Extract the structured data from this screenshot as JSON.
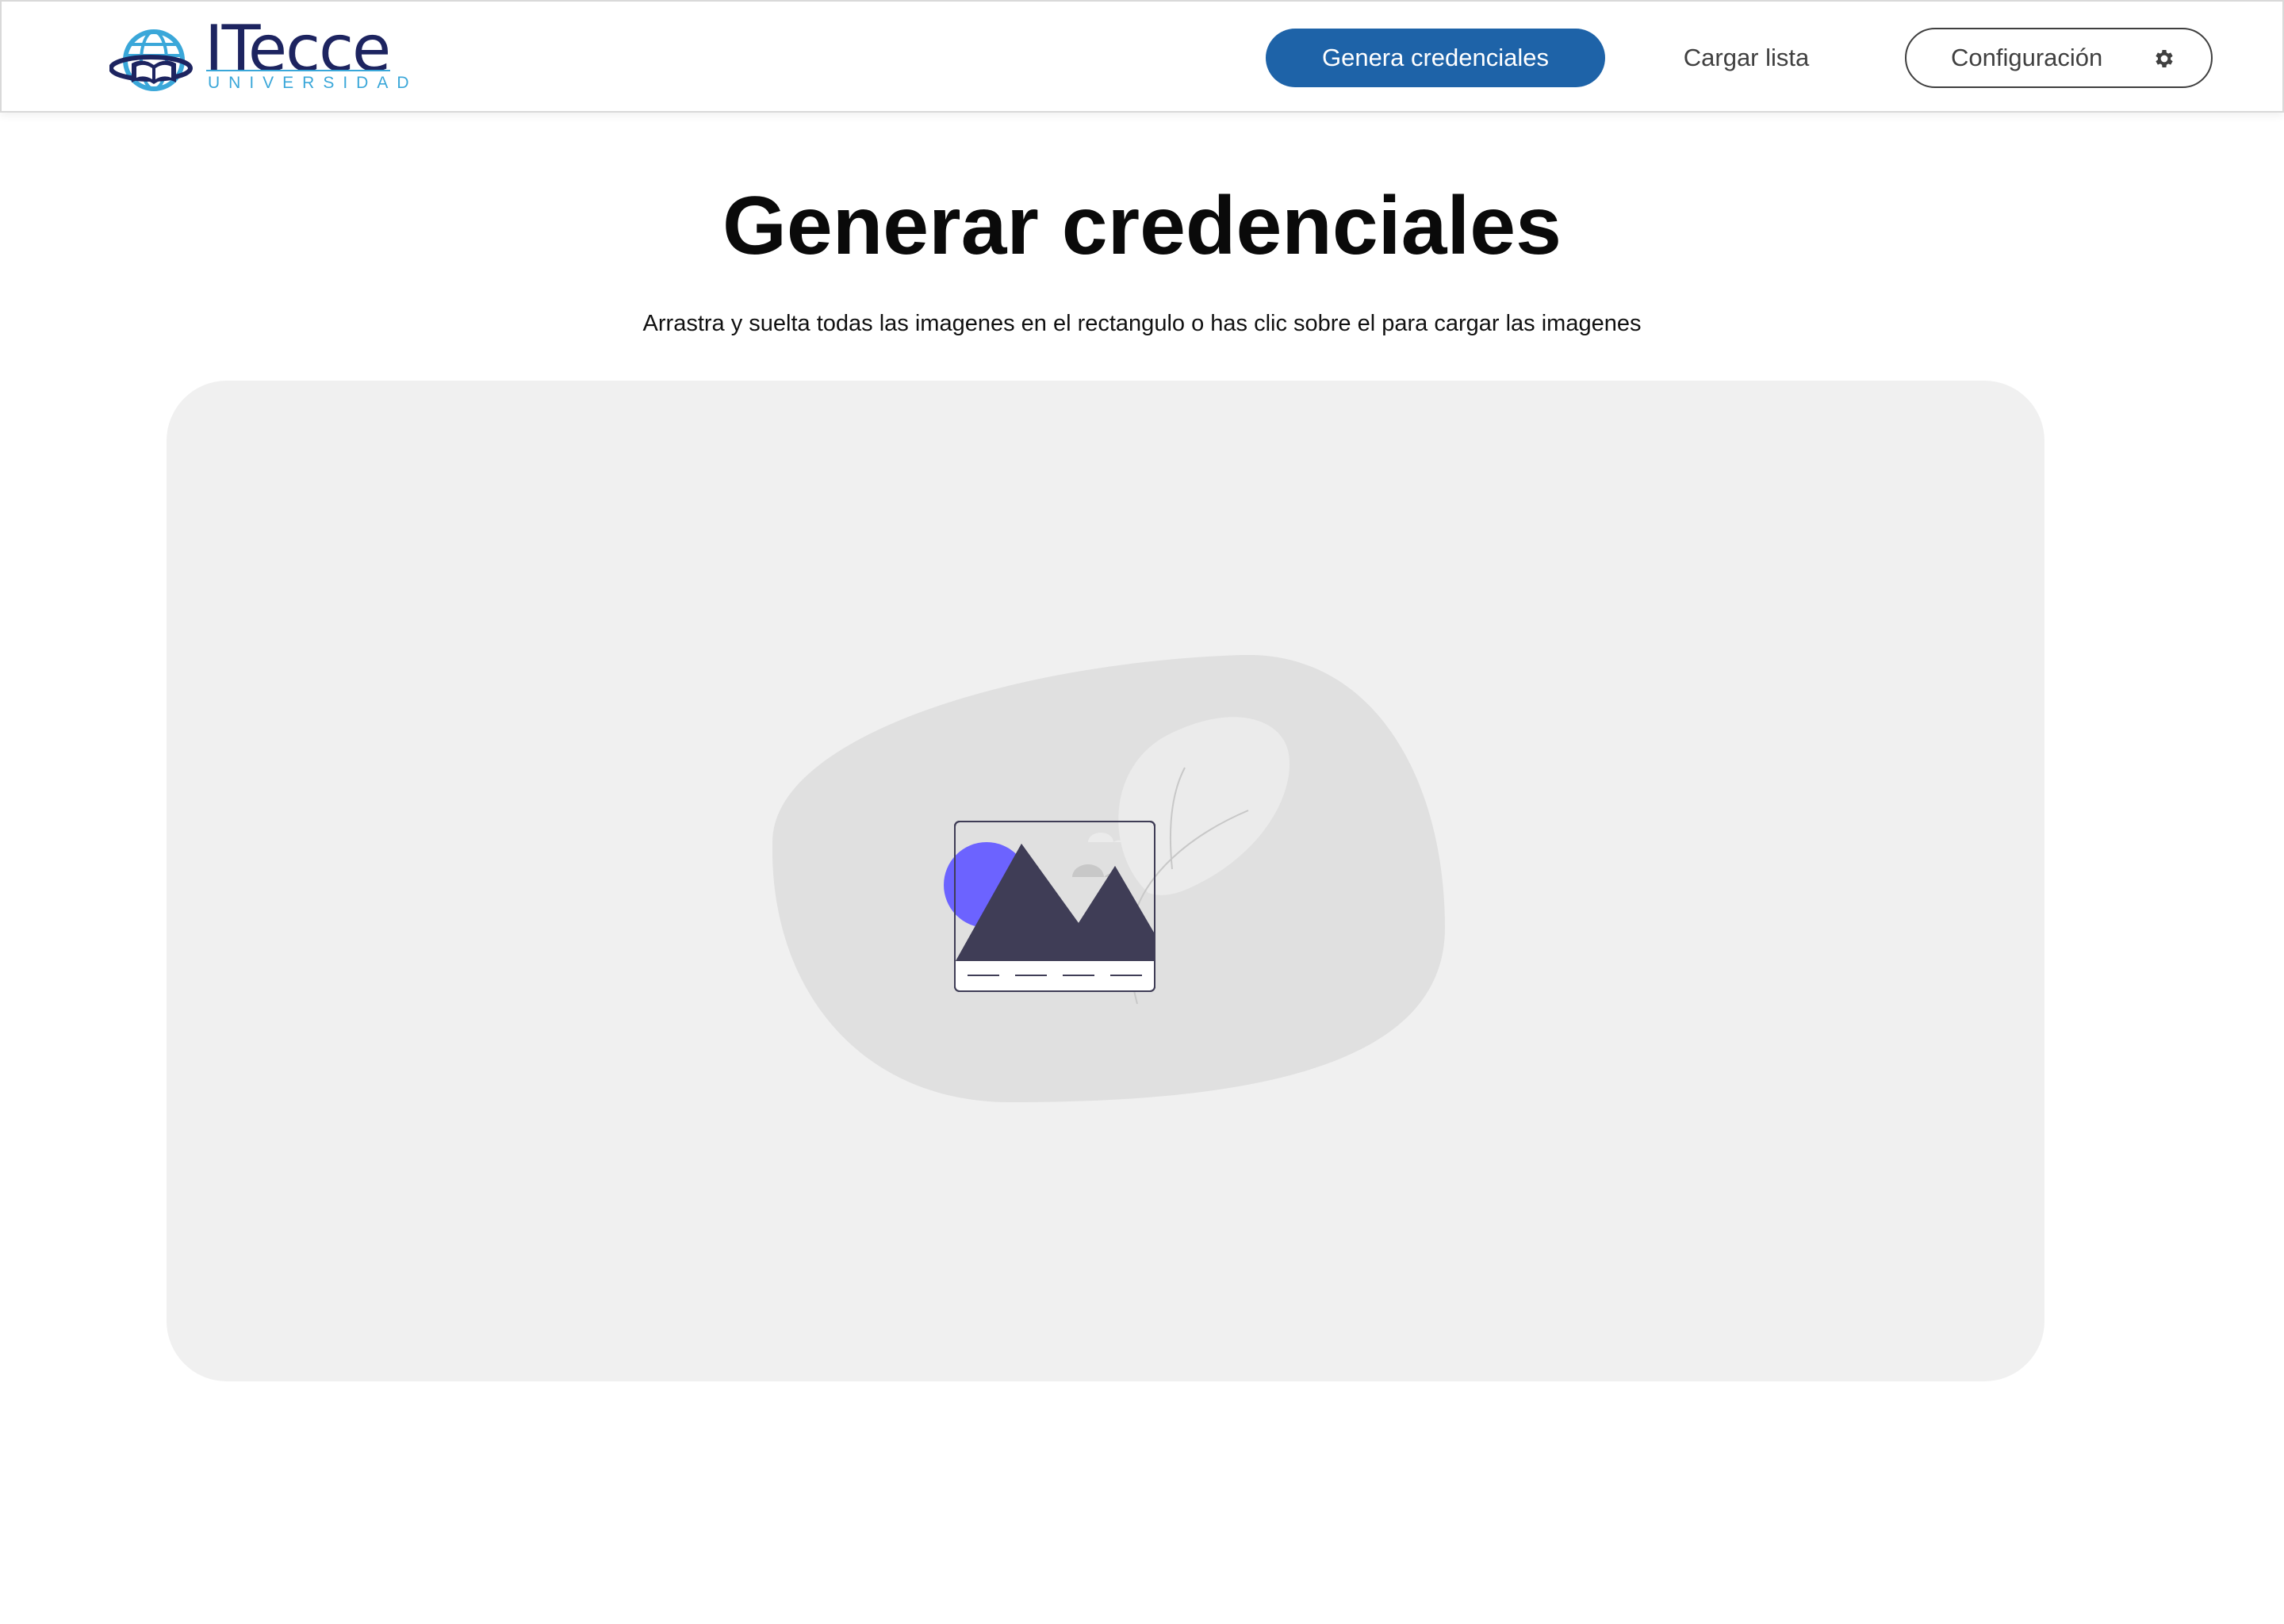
{
  "brand": {
    "name": "ITecce",
    "subtitle": "UNIVERSIDAD",
    "colors": {
      "dark": "#1d2460",
      "light": "#3aa7d9"
    }
  },
  "nav": {
    "primary_label": "Genera credenciales",
    "upload_list_label": "Cargar lista",
    "settings_label": "Configuración",
    "settings_icon": "gear-icon",
    "primary_color": "#1e63a8"
  },
  "main": {
    "title": "Generar credenciales",
    "instructions": "Arrastra y suelta todas las imagenes en el rectangulo o has clic sobre el para cargar las imagenes"
  },
  "dropzone": {
    "illustration": "image-upload-illustration",
    "accent_color": "#6c63ff",
    "mountain_color": "#3f3d56"
  }
}
